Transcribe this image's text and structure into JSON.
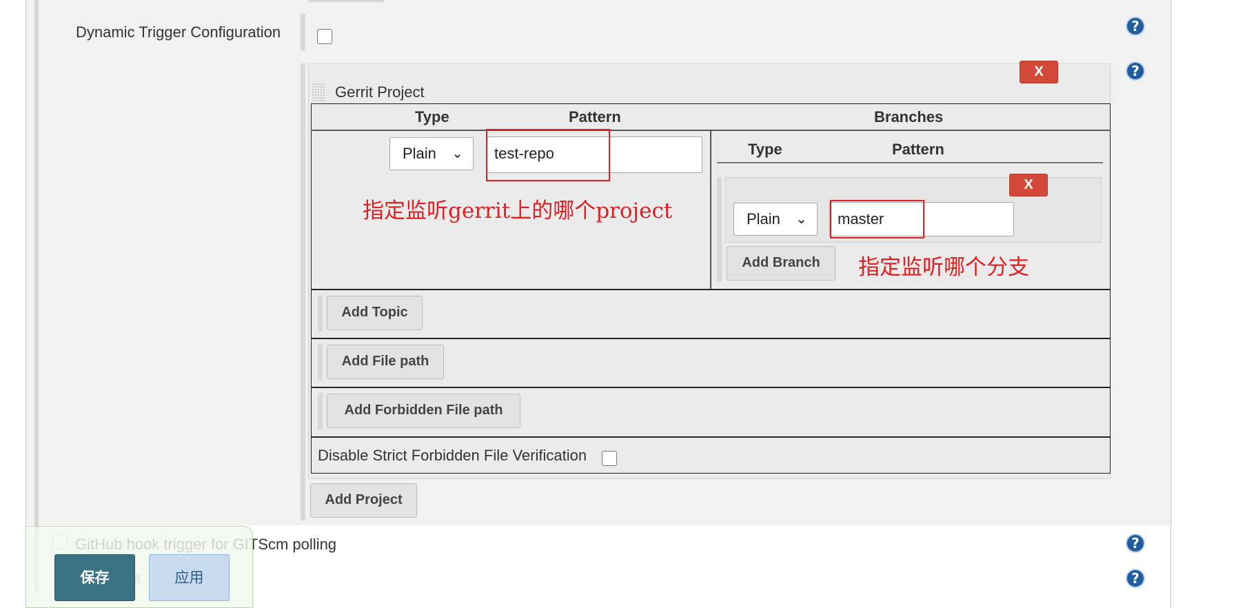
{
  "dynamic_trigger": {
    "label": "Dynamic Trigger Configuration",
    "checked": false
  },
  "gerrit_project": {
    "title": "Gerrit Project",
    "delete_label": "X",
    "header": {
      "type": "Type",
      "pattern": "Pattern",
      "branches": "Branches"
    },
    "project_type": "Plain",
    "project_pattern": "test-repo",
    "branches": {
      "header_type": "Type",
      "header_pattern": "Pattern",
      "delete_label": "X",
      "type": "Plain",
      "pattern": "master",
      "add_branch": "Add Branch"
    },
    "add_topic": "Add Topic",
    "add_file_path": "Add File path",
    "add_forbidden_file_path": "Add Forbidden File path",
    "disable_strict_label": "Disable Strict Forbidden File Verification"
  },
  "add_project": "Add Project",
  "annotations": {
    "project_note": "指定监听gerrit上的哪个project",
    "branch_note": "指定监听哪个分支"
  },
  "github_hook": {
    "label": "GitHub hook trigger for GITScm polling",
    "checked": false
  },
  "partial_item_text": "M",
  "help_icon_text": "?",
  "bottom_bar": {
    "save": "保存",
    "apply": "应用"
  },
  "colors": {
    "delete": "#d24939",
    "annotation": "#e02020",
    "help": "#1f5d9e",
    "save": "#3c7384"
  }
}
